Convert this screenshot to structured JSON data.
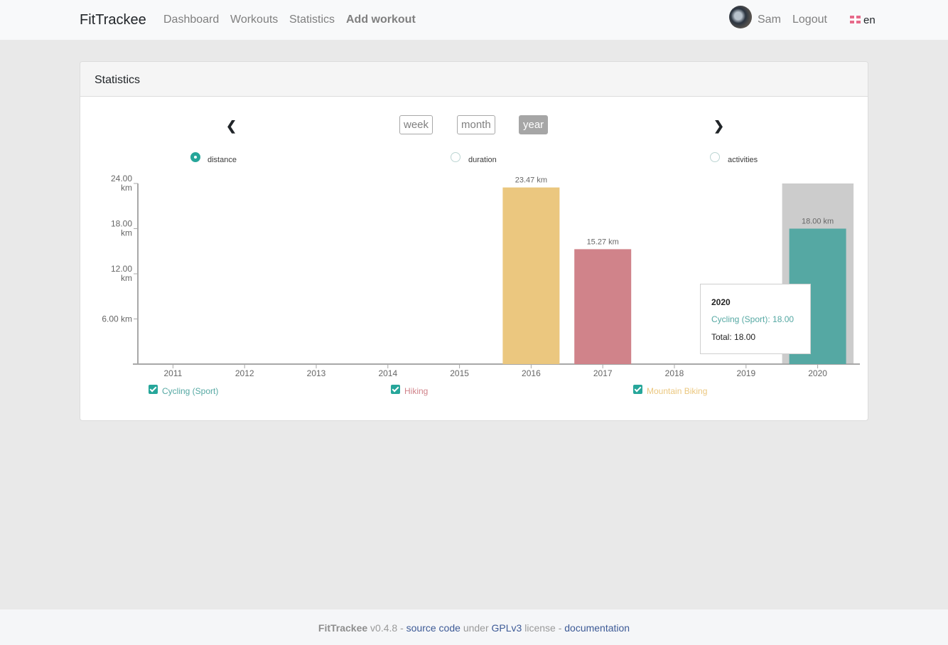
{
  "navbar": {
    "brand": "FitTrackee",
    "links": [
      "Dashboard",
      "Workouts",
      "Statistics",
      "Add workout"
    ],
    "user": "Sam",
    "logout": "Logout",
    "language": "en"
  },
  "stats": {
    "title": "Statistics",
    "prev_icon": "chevron-left-icon",
    "next_icon": "chevron-right-icon",
    "periods": [
      "week",
      "month",
      "year"
    ],
    "active_period": "year",
    "metrics": [
      "distance",
      "duration",
      "activities"
    ],
    "active_metric": "distance"
  },
  "chart_data": {
    "type": "bar",
    "stacked": true,
    "categories": [
      "2011",
      "2012",
      "2013",
      "2014",
      "2015",
      "2016",
      "2017",
      "2018",
      "2019",
      "2020"
    ],
    "series": [
      {
        "name": "Cycling (Sport)",
        "color": "#55a8a3",
        "values": [
          0,
          0,
          0,
          0,
          0,
          0,
          0,
          0,
          0,
          18.0
        ]
      },
      {
        "name": "Hiking",
        "color": "#d0838a",
        "values": [
          0,
          0,
          0,
          0,
          0,
          0,
          15.27,
          0,
          0,
          0
        ]
      },
      {
        "name": "Mountain Biking",
        "color": "#ebc77f",
        "values": [
          0,
          0,
          0,
          0,
          0,
          23.47,
          0,
          0,
          0,
          0
        ]
      }
    ],
    "totals_labels": {
      "2016": "23.47 km",
      "2017": "15.27 km",
      "2020": "18.00 km"
    },
    "ylim": [
      0,
      24
    ],
    "yticks": [
      {
        "value": 6,
        "label": "6.00 km"
      },
      {
        "value": 12,
        "label": "12.00 km"
      },
      {
        "value": 18,
        "label": "18.00 km"
      },
      {
        "value": 24,
        "label": "24.00 km"
      }
    ],
    "xlabel": "",
    "ylabel": "",
    "legend_position": "bottom",
    "hovered_category": "2020",
    "tooltip": {
      "title": "2020",
      "line": "Cycling (Sport): 18.00",
      "total": "Total: 18.00"
    }
  },
  "footer": {
    "app": "FitTrackee",
    "version": "v0.4.8 -",
    "source": "source code",
    "under": "under",
    "license_link": "GPLv3",
    "license": "license -",
    "docs": "documentation"
  }
}
